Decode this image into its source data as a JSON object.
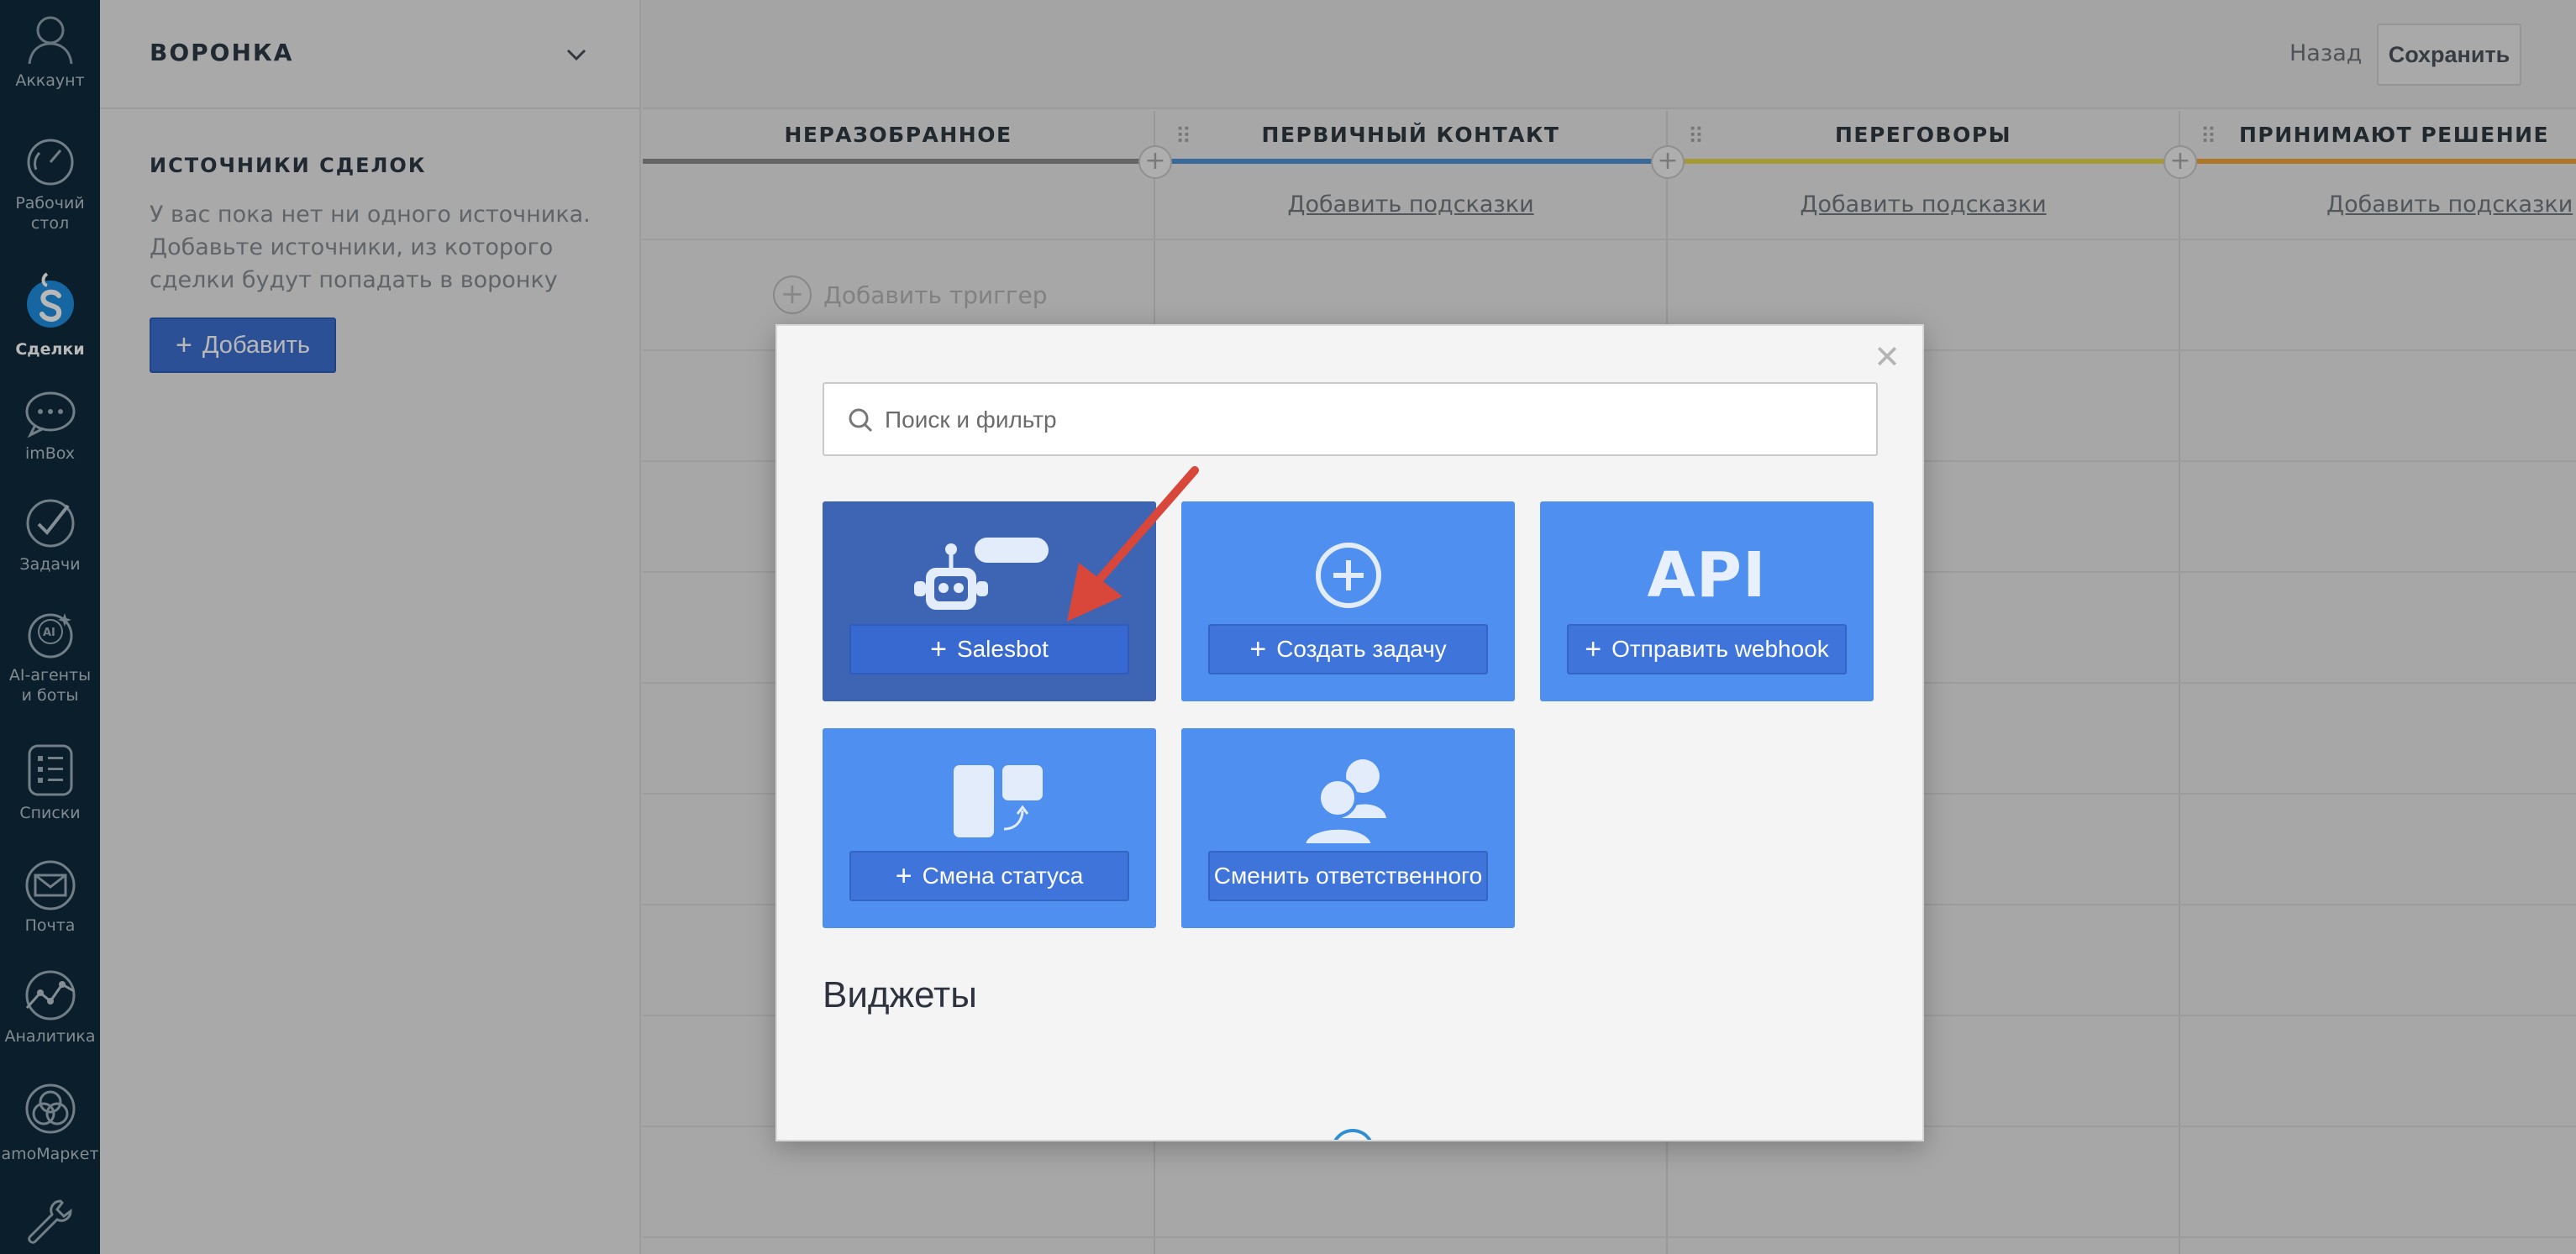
{
  "nav": {
    "items": [
      {
        "label": "Аккаунт",
        "icon": "account-icon"
      },
      {
        "label": "Рабочий\nстол",
        "icon": "dashboard-icon"
      },
      {
        "label": "Сделки",
        "icon": "deals-icon",
        "active": true
      },
      {
        "label": "imBox",
        "icon": "chat-icon"
      },
      {
        "label": "Задачи",
        "icon": "tasks-icon"
      },
      {
        "label": "AI-агенты\nи боты",
        "icon": "ai-agents-icon"
      },
      {
        "label": "Списки",
        "icon": "lists-icon"
      },
      {
        "label": "Почта",
        "icon": "mail-icon"
      },
      {
        "label": "Аналитика",
        "icon": "analytics-icon"
      },
      {
        "label": "amoМаркет",
        "icon": "market-icon"
      },
      {
        "label": "",
        "icon": "settings-icon"
      }
    ]
  },
  "panel": {
    "pipeline_title": "ВОРОНКА",
    "sources_title": "ИСТОЧНИКИ СДЕЛОК",
    "sources_text": "У вас пока нет ни одного источника. Добавьте источники, из которого сделки будут попадать в воронку",
    "add_button": "Добавить"
  },
  "topbar": {
    "back_label": "Назад",
    "save_label": "Сохранить"
  },
  "stages": [
    {
      "name": "НЕРАЗОБРАННОЕ",
      "color": "#8c8c8c",
      "hint": ""
    },
    {
      "name": "ПЕРВИЧНЫЙ КОНТАКТ",
      "color": "#4f90d6",
      "hint": "Добавить подсказки"
    },
    {
      "name": "ПЕРЕГОВОРЫ",
      "color": "#e5d54c",
      "hint": "Добавить подсказки"
    },
    {
      "name": "ПРИНИМАЮТ РЕШЕНИЕ",
      "color": "#f0a43a",
      "hint": "Добавить подсказки"
    }
  ],
  "board": {
    "add_trigger_label": "Добавить триггер"
  },
  "modal": {
    "search_placeholder": "Поиск и фильтр",
    "cards": [
      {
        "label": "Salesbot",
        "icon": "robot-icon",
        "plus": true
      },
      {
        "label": "Создать задачу",
        "icon": "plus-circle-icon",
        "plus": true
      },
      {
        "label": "Отправить webhook",
        "icon": "api-icon",
        "art_text": "API",
        "plus": true
      },
      {
        "label": "Смена статуса",
        "icon": "status-change-icon",
        "plus": true
      },
      {
        "label": "Сменить ответственного",
        "icon": "change-responsible-icon",
        "plus": false
      }
    ],
    "widgets_title": "Виджеты"
  },
  "colors": {
    "nav_bg": "#0f2a3d",
    "card_blue": "#4f8ff0",
    "card_selected": "#3d65b3",
    "button_blue": "#3c6fd0",
    "annotation_arrow": "#d9463a"
  }
}
